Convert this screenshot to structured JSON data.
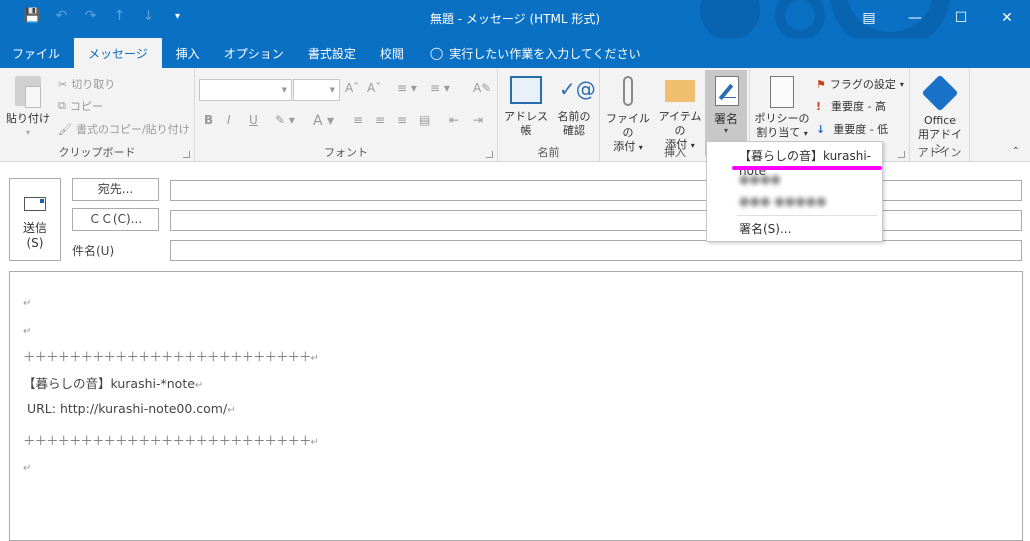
{
  "window": {
    "title": "無題 - メッセージ (HTML 形式)",
    "qat": [
      "save-icon",
      "undo-icon",
      "redo-icon",
      "up-icon",
      "down-icon",
      "customize-icon"
    ],
    "controls": [
      "ribbon-display-icon",
      "minimize-icon",
      "maximize-icon",
      "close-icon"
    ]
  },
  "tabs": [
    {
      "label": "ファイル",
      "active": false
    },
    {
      "label": "メッセージ",
      "active": true
    },
    {
      "label": "挿入",
      "active": false
    },
    {
      "label": "オプション",
      "active": false
    },
    {
      "label": "書式設定",
      "active": false
    },
    {
      "label": "校閲",
      "active": false
    }
  ],
  "tellme": {
    "placeholder": "実行したい作業を入力してください"
  },
  "ribbon": {
    "clipboard": {
      "label": "クリップボード",
      "paste": "貼り付け",
      "cut": "切り取り",
      "copy": "コピー",
      "format_painter": "書式のコピー/貼り付け"
    },
    "font": {
      "label": "フォント",
      "font_name": "",
      "font_size": ""
    },
    "names": {
      "label": "名前",
      "address_book": "アドレス帳",
      "check_names_1": "名前の",
      "check_names_2": "確認"
    },
    "insert": {
      "label": "挿入",
      "attach_file_1": "ファイルの",
      "attach_file_2": "添付",
      "attach_item_1": "アイテムの",
      "attach_item_2": "添付",
      "signature": "署名"
    },
    "tags": {
      "policy_1": "ポリシーの",
      "policy_2": "割り当て",
      "flag": "フラグの設定",
      "high": "重要度 - 高",
      "low": "重要度 - 低"
    },
    "addins": {
      "label": "アドイン",
      "office_1": "Office",
      "office_2": "用アドイン"
    }
  },
  "signature_menu": {
    "items": [
      {
        "label": "【暮らしの音】kurashi-note",
        "highlighted": true
      },
      {
        "label": "●●●●",
        "redacted": true
      },
      {
        "label": "●●● ●●●●●",
        "redacted": true
      },
      {
        "label": "署名(S)..."
      }
    ],
    "highlight_color": "#ff00ff"
  },
  "compose": {
    "send_label": "送信",
    "send_key": "(S)",
    "to_label": "宛先...",
    "cc_label": "ＣＣ(C)...",
    "subject_label": "件名(U)",
    "to_value": "",
    "cc_value": "",
    "subject_value": ""
  },
  "body": {
    "lines": [
      "",
      "",
      "＋＋＋＋＋＋＋＋＋＋＋＋＋＋＋＋＋＋＋＋＋＋＋＋＋",
      "【暮らしの音】kurashi-*note",
      " URL: http://kurashi-note00.com/",
      "＋＋＋＋＋＋＋＋＋＋＋＋＋＋＋＋＋＋＋＋＋＋＋＋＋",
      ""
    ],
    "return_mark": "↵"
  },
  "colors": {
    "accent": "#0a70c4",
    "ribbon_bg": "#f3f3f3"
  }
}
